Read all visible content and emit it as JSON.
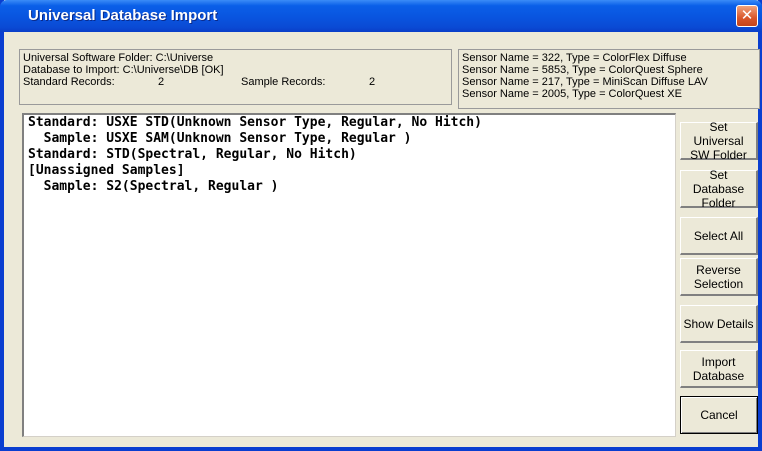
{
  "window": {
    "title": "Universal Database Import",
    "close_glyph": "✕"
  },
  "info_left": {
    "software_folder": "Universal Software Folder: C:\\Universe",
    "database": "Database to Import: C:\\Universe\\DB [OK]",
    "standard_records_label": "Standard Records:",
    "standard_records_value": "2",
    "sample_records_label": "Sample Records:",
    "sample_records_value": "2"
  },
  "sensors": [
    "Sensor Name = 322, Type = ColorFlex Diffuse",
    "Sensor Name = 5853, Type = ColorQuest Sphere",
    "Sensor Name = 217, Type = MiniScan Diffuse LAV",
    "Sensor Name = 2005, Type = ColorQuest XE"
  ],
  "records": [
    "Standard: USXE STD(Unknown Sensor Type, Regular, No Hitch)",
    "  Sample: USXE SAM(Unknown Sensor Type, Regular )",
    "Standard: STD(Spectral, Regular, No Hitch)",
    "[Unassigned Samples]",
    "  Sample: S2(Spectral, Regular )"
  ],
  "buttons": {
    "set_universal_sw_folder": "Set Universal\nSW Folder",
    "set_database_folder": "Set Database\nFolder",
    "select_all": "Select All",
    "reverse_selection": "Reverse\nSelection",
    "show_details": "Show Details",
    "import_database": "Import\nDatabase",
    "cancel": "Cancel"
  }
}
